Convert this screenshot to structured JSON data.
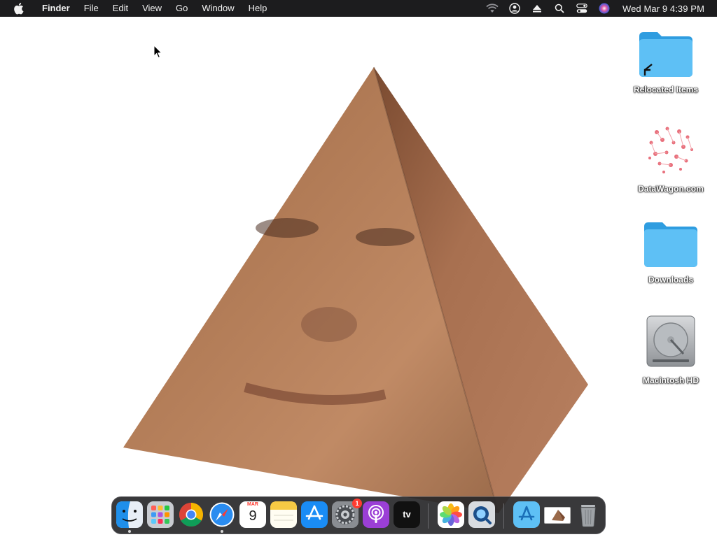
{
  "menubar": {
    "app_name": "Finder",
    "menus": [
      "File",
      "Edit",
      "View",
      "Go",
      "Window",
      "Help"
    ],
    "clock": "Wed Mar 9  4:39 PM",
    "status_icons": [
      "wifi-icon",
      "user-account-icon",
      "eject-icon",
      "spotlight-search-icon",
      "control-center-icon",
      "siri-icon"
    ]
  },
  "desktop": {
    "icons": [
      {
        "label": "Relocated Items",
        "kind": "folder-alias"
      },
      {
        "label": "DataWagon.com",
        "kind": "image"
      },
      {
        "label": "Downloads",
        "kind": "folder"
      },
      {
        "label": "Macintosh HD",
        "kind": "hard-drive"
      }
    ]
  },
  "dock": {
    "apps": [
      {
        "name": "Finder",
        "icon": "finder-icon",
        "running": true
      },
      {
        "name": "Launchpad",
        "icon": "launchpad-icon",
        "running": false
      },
      {
        "name": "Google Chrome",
        "icon": "chrome-icon",
        "running": false
      },
      {
        "name": "Safari",
        "icon": "safari-icon",
        "running": true
      },
      {
        "name": "Calendar",
        "icon": "calendar-icon",
        "running": false,
        "month": "MAR",
        "day": "9"
      },
      {
        "name": "Notes",
        "icon": "notes-icon",
        "running": false
      },
      {
        "name": "App Store",
        "icon": "app-store-icon",
        "running": false
      },
      {
        "name": "System Preferences",
        "icon": "system-preferences-icon",
        "running": false,
        "badge": "1"
      },
      {
        "name": "Podcasts",
        "icon": "podcasts-icon",
        "running": false
      },
      {
        "name": "TV",
        "icon": "apple-tv-icon",
        "running": false,
        "label": "tv"
      },
      {
        "name": "Photos",
        "icon": "photos-icon",
        "running": false
      },
      {
        "name": "QuickTime Player",
        "icon": "quicktime-icon",
        "running": false
      }
    ],
    "docked_items": [
      {
        "name": "Applications",
        "icon": "applications-folder-icon"
      },
      {
        "name": "Pyramid Image",
        "icon": "image-thumbnail-icon"
      },
      {
        "name": "Trash",
        "icon": "trash-icon"
      }
    ]
  },
  "colors": {
    "menubar_bg": "#1c1c1e",
    "folder_blue": "#4fb3f0",
    "dock_bg": "#28282a",
    "badge_red": "#ff3b30"
  }
}
